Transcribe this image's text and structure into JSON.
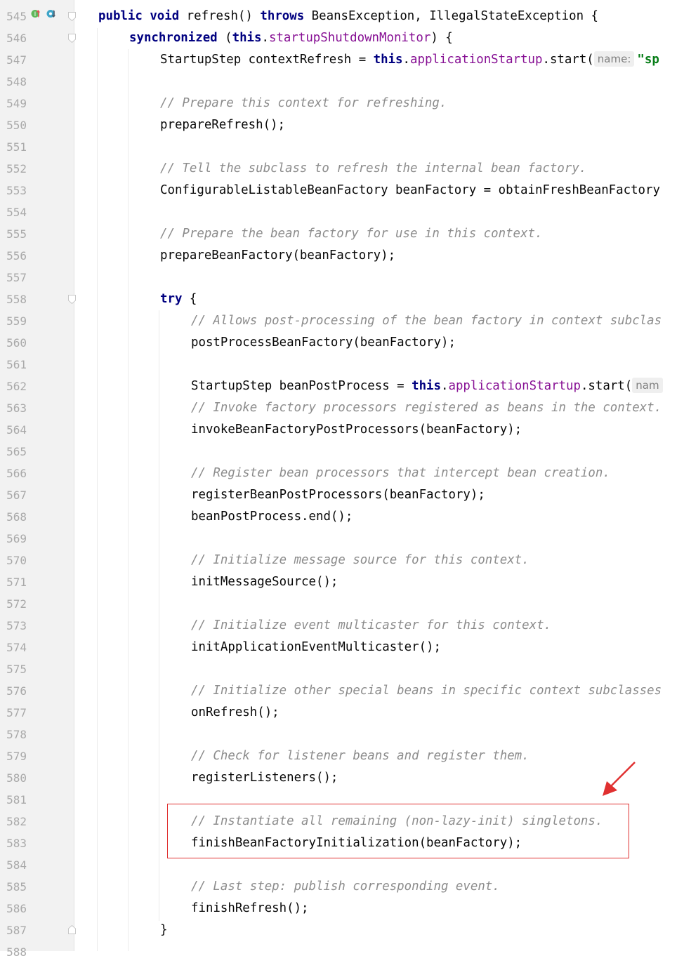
{
  "gutter": {
    "line_numbers": [
      "545",
      "546",
      "547",
      "548",
      "549",
      "550",
      "551",
      "552",
      "553",
      "554",
      "555",
      "556",
      "557",
      "558",
      "559",
      "560",
      "561",
      "562",
      "563",
      "564",
      "565",
      "566",
      "567",
      "568",
      "569",
      "570",
      "571",
      "572",
      "573",
      "574",
      "575",
      "576",
      "577",
      "578",
      "579",
      "580",
      "581",
      "582",
      "583",
      "584",
      "585",
      "586",
      "587",
      "588"
    ]
  },
  "colors": {
    "keyword": "#0033b3",
    "field": "#871094",
    "comment": "#8c8c8c",
    "string": "#067d17",
    "highlight_border": "#e03030",
    "gutter_bg": "#f2f2f2"
  },
  "code": {
    "l545": {
      "kw1": "public",
      "kw2": "void",
      "name": " refresh() ",
      "kw3": "throws",
      "rest": " BeansException, IllegalStateException {"
    },
    "l546": {
      "kw": "synchronized",
      "open": " (",
      "this": "this",
      "dot": ".",
      "field": "startupShutdownMonitor",
      "close": ") {"
    },
    "l547": {
      "pre": "StartupStep contextRefresh = ",
      "this": "this",
      "dot": ".",
      "field": "applicationStartup",
      "call": ".start(",
      "hint": "name:",
      "str": "\"sp"
    },
    "l549": "// Prepare this context for refreshing.",
    "l550": "prepareRefresh();",
    "l552": "// Tell the subclass to refresh the internal bean factory.",
    "l553": "ConfigurableListableBeanFactory beanFactory = obtainFreshBeanFactory",
    "l555": "// Prepare the bean factory for use in this context.",
    "l556": "prepareBeanFactory(beanFactory);",
    "l558": {
      "kw": "try",
      "rest": " {"
    },
    "l559": "// Allows post-processing of the bean factory in context subclas",
    "l560": "postProcessBeanFactory(beanFactory);",
    "l562": {
      "pre": "StartupStep beanPostProcess = ",
      "this": "this",
      "dot": ".",
      "field": "applicationStartup",
      "call": ".start(",
      "hint": "nam"
    },
    "l563": "// Invoke factory processors registered as beans in the context.",
    "l564": "invokeBeanFactoryPostProcessors(beanFactory);",
    "l566": "// Register bean processors that intercept bean creation.",
    "l567": "registerBeanPostProcessors(beanFactory);",
    "l568": "beanPostProcess.end();",
    "l570": "// Initialize message source for this context.",
    "l571": "initMessageSource();",
    "l573": "// Initialize event multicaster for this context.",
    "l574": "initApplicationEventMulticaster();",
    "l576": "// Initialize other special beans in specific context subclasses",
    "l577": "onRefresh();",
    "l579": "// Check for listener beans and register them.",
    "l580": "registerListeners();",
    "l582": "// Instantiate all remaining (non-lazy-init) singletons.",
    "l583": "finishBeanFactoryInitialization(beanFactory);",
    "l585": "// Last step: publish corresponding event.",
    "l586": "finishRefresh();",
    "l587": "}"
  },
  "icons": {
    "override": "override-up-icon",
    "implemented": "implemented-down-icon",
    "fold": "fold-marker-icon",
    "annotation_arrow": "red-arrow-icon"
  }
}
